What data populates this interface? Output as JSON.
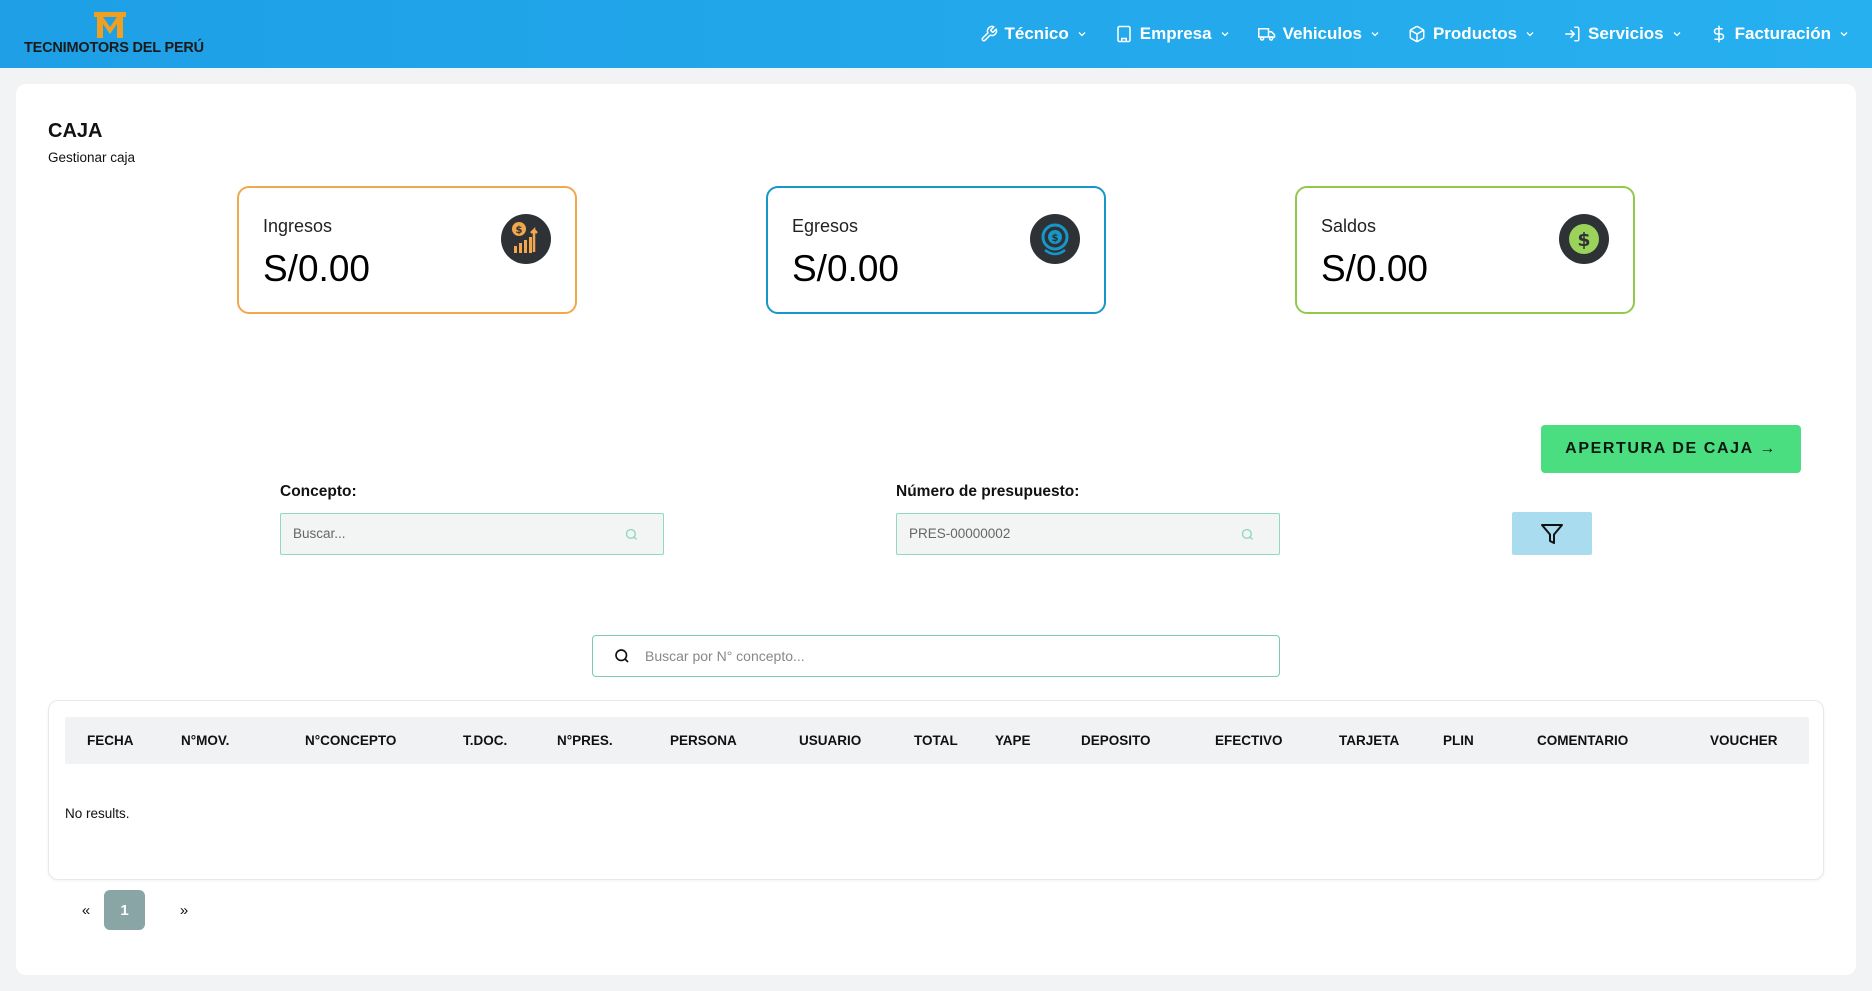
{
  "brand": {
    "name": "TECNIMOTORS DEL PERÚ",
    "logo_letter": "M"
  },
  "nav": [
    {
      "label": "Técnico",
      "icon": "wrench-icon"
    },
    {
      "label": "Empresa",
      "icon": "building-icon"
    },
    {
      "label": "Vehiculos",
      "icon": "truck-icon"
    },
    {
      "label": "Productos",
      "icon": "box-icon"
    },
    {
      "label": "Servicios",
      "icon": "service-icon"
    },
    {
      "label": "Facturación",
      "icon": "dollar-icon"
    }
  ],
  "page": {
    "title": "CAJA",
    "subtitle": "Gestionar caja"
  },
  "stats": {
    "ingresos": {
      "label": "Ingresos",
      "value": "S/0.00",
      "color": "#f3a74c"
    },
    "egresos": {
      "label": "Egresos",
      "value": "S/0.00",
      "color": "#1597c8"
    },
    "saldos": {
      "label": "Saldos",
      "value": "S/0.00",
      "color": "#92c94c"
    }
  },
  "actions": {
    "apertura_label": "APERTURA DE CAJA →"
  },
  "filters": {
    "concepto": {
      "label": "Concepto:",
      "placeholder": "Buscar..."
    },
    "presupuesto": {
      "label": "Número de presupuesto:",
      "placeholder": "PRES-00000002"
    }
  },
  "search": {
    "placeholder": "Buscar por N° concepto..."
  },
  "table": {
    "columns": [
      "FECHA",
      "N°MOV.",
      "N°CONCEPTO",
      "T.DOC.",
      "N°PRES.",
      "PERSONA",
      "USUARIO",
      "TOTAL",
      "YAPE",
      "DEPOSITO",
      "EFECTIVO",
      "TARJETA",
      "PLIN",
      "COMENTARIO",
      "VOUCHER"
    ],
    "empty_text": "No results."
  },
  "pagination": {
    "prev": "«",
    "current": "1",
    "next": "»"
  },
  "colors": {
    "navbar": "#1e9fe6",
    "apertura": "#4ade80",
    "filter": "#a9dcee",
    "pager_active": "#8aa5a6"
  }
}
